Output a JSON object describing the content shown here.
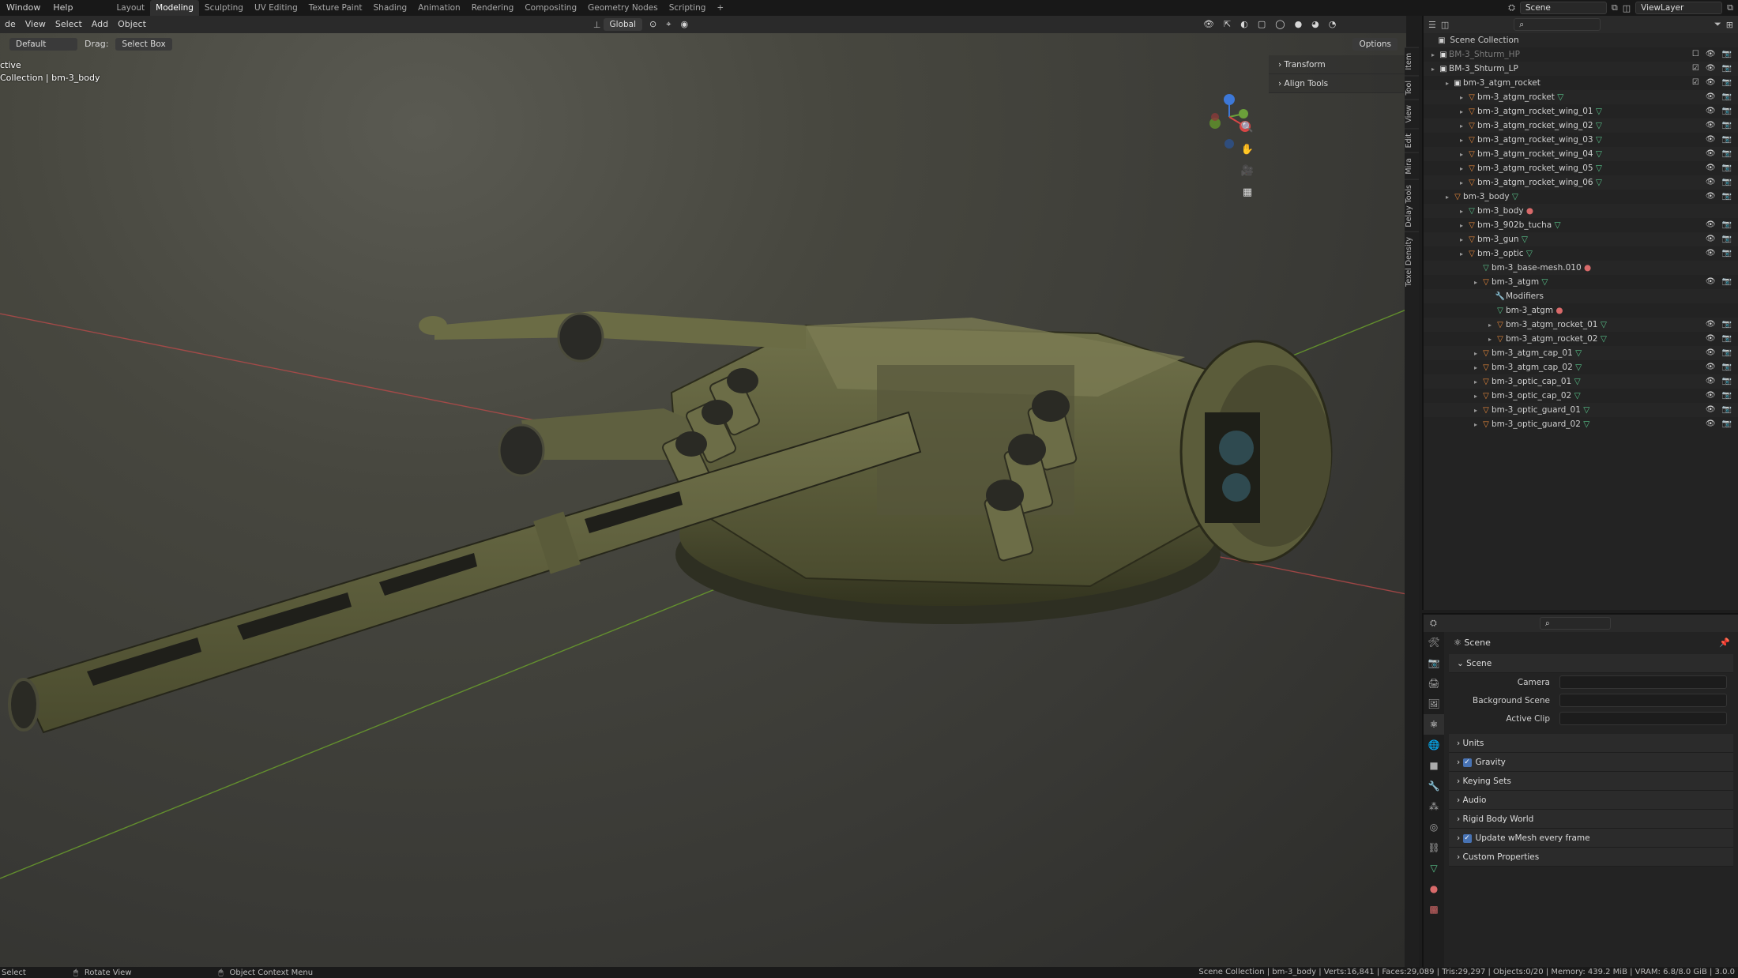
{
  "topbar": {
    "menus": [
      "Window",
      "Help"
    ],
    "workspaces": [
      "Layout",
      "Modeling",
      "Sculpting",
      "UV Editing",
      "Texture Paint",
      "Shading",
      "Animation",
      "Rendering",
      "Compositing",
      "Geometry Nodes",
      "Scripting"
    ],
    "active_workspace": "Modeling",
    "add_tab": "+",
    "scene_field": "Scene",
    "viewlayer_field": "ViewLayer"
  },
  "viewport_header": {
    "mode_label": "de",
    "menus": [
      "View",
      "Select",
      "Add",
      "Object"
    ],
    "orientation": "Global",
    "options_label": "Options"
  },
  "tool_settings": {
    "orientation_label": "Default",
    "drag_label": "Drag:",
    "drag_value": "Select Box"
  },
  "viewport_overlay": {
    "line1": "ctive",
    "line2": "Collection | bm-3_body"
  },
  "npanel": {
    "panels": [
      "Transform",
      "Align Tools"
    ],
    "tabs": [
      "Item",
      "Tool",
      "View",
      "Edit",
      "Mira",
      "Delay Tools",
      "Texel Density"
    ]
  },
  "outliner": {
    "root": "Scene Collection",
    "rows": [
      {
        "label": "BM-3_Shturm_HP",
        "level": 0,
        "icon": "collection",
        "dim": true
      },
      {
        "label": "BM-3_Shturm_LP",
        "level": 0,
        "icon": "collection"
      },
      {
        "label": "bm-3_atgm_rocket",
        "level": 1,
        "icon": "collection"
      },
      {
        "label": "bm-3_atgm_rocket",
        "level": 2,
        "icon": "object"
      },
      {
        "label": "bm-3_atgm_rocket_wing_01",
        "level": 2,
        "icon": "object"
      },
      {
        "label": "bm-3_atgm_rocket_wing_02",
        "level": 2,
        "icon": "object"
      },
      {
        "label": "bm-3_atgm_rocket_wing_03",
        "level": 2,
        "icon": "object"
      },
      {
        "label": "bm-3_atgm_rocket_wing_04",
        "level": 2,
        "icon": "object"
      },
      {
        "label": "bm-3_atgm_rocket_wing_05",
        "level": 2,
        "icon": "object"
      },
      {
        "label": "bm-3_atgm_rocket_wing_06",
        "level": 2,
        "icon": "object"
      },
      {
        "label": "bm-3_body",
        "level": 1,
        "icon": "object"
      },
      {
        "label": "bm-3_body",
        "level": 2,
        "icon": "mesh"
      },
      {
        "label": "bm-3_902b_tucha",
        "level": 2,
        "icon": "object"
      },
      {
        "label": "bm-3_gun",
        "level": 2,
        "icon": "object"
      },
      {
        "label": "bm-3_optic",
        "level": 2,
        "icon": "object"
      },
      {
        "label": "bm-3_base-mesh.010",
        "level": 3,
        "icon": "mesh"
      },
      {
        "label": "bm-3_atgm",
        "level": 3,
        "icon": "object"
      },
      {
        "label": "Modifiers",
        "level": 4,
        "icon": "modifier"
      },
      {
        "label": "bm-3_atgm",
        "level": 4,
        "icon": "mesh"
      },
      {
        "label": "bm-3_atgm_rocket_01",
        "level": 4,
        "icon": "object"
      },
      {
        "label": "bm-3_atgm_rocket_02",
        "level": 4,
        "icon": "object"
      },
      {
        "label": "bm-3_atgm_cap_01",
        "level": 3,
        "icon": "object"
      },
      {
        "label": "bm-3_atgm_cap_02",
        "level": 3,
        "icon": "object"
      },
      {
        "label": "bm-3_optic_cap_01",
        "level": 3,
        "icon": "object"
      },
      {
        "label": "bm-3_optic_cap_02",
        "level": 3,
        "icon": "object"
      },
      {
        "label": "bm-3_optic_guard_01",
        "level": 3,
        "icon": "object"
      },
      {
        "label": "bm-3_optic_guard_02",
        "level": 3,
        "icon": "object"
      }
    ]
  },
  "properties": {
    "context_title": "Scene",
    "section_title": "Scene",
    "fields": [
      {
        "label": "Camera"
      },
      {
        "label": "Background Scene"
      },
      {
        "label": "Active Clip"
      }
    ],
    "subpanels": [
      {
        "label": "Units",
        "checkbox": false
      },
      {
        "label": "Gravity",
        "checkbox": true
      },
      {
        "label": "Keying Sets",
        "checkbox": false
      },
      {
        "label": "Audio",
        "checkbox": false
      },
      {
        "label": "Rigid Body World",
        "checkbox": false
      },
      {
        "label": "Update wMesh every frame",
        "checkbox": true
      },
      {
        "label": "Custom Properties",
        "checkbox": false
      }
    ]
  },
  "statusbar": {
    "left1": "Select",
    "left2": "Rotate View",
    "left3": "Object Context Menu",
    "right": "Scene Collection | bm-3_body | Verts:16,841 | Faces:29,089 | Tris:29,297 | Objects:0/20 | Memory: 439.2 MiB | VRAM: 6.8/8.0 GiB | 3.0.0"
  },
  "colors": {
    "accent": "#4772b3",
    "x_axis": "#c0392b",
    "y_axis": "#6a9e2c",
    "model_olive": "#5b5c3a"
  }
}
